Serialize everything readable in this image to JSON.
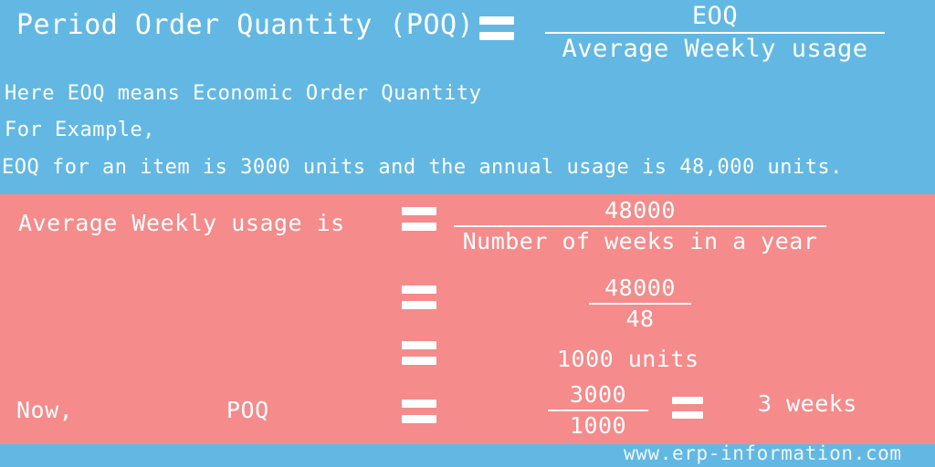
{
  "colors": {
    "blue_background": "#62b8e3",
    "pink_background": "#f58b8b",
    "text": "#ffffff",
    "watermark": "#eef6fb"
  },
  "top_section": {
    "title": "Period Order Quantity (POQ)",
    "equals": "=",
    "formula": {
      "numerator": "EOQ",
      "denominator": "Average Weekly usage"
    },
    "notes": [
      "Here EOQ means Economic Order Quantity",
      "For Example,",
      "EOQ for an item is 3000 units and the annual usage is 48,000 units."
    ]
  },
  "pink_section": {
    "rows": [
      {
        "label": "Average Weekly usage is",
        "equals": "=",
        "numerator": "48000",
        "denominator": "Number of weeks in a year"
      },
      {
        "label": "",
        "equals": "=",
        "numerator": "48000",
        "denominator": "48"
      },
      {
        "label": "",
        "equals": "=",
        "value": "1000 units"
      },
      {
        "label": "Now,",
        "subject": "POQ",
        "equals": "=",
        "numerator": "3000",
        "denominator": "1000",
        "equals2": "=",
        "result": "3 weeks"
      }
    ]
  },
  "footer": {
    "watermark": "www.erp-information.com"
  }
}
